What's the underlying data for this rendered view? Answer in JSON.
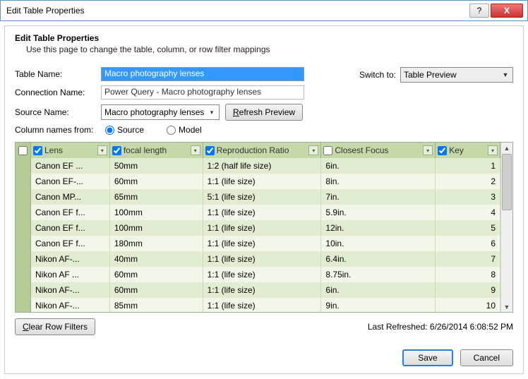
{
  "window": {
    "title": "Edit Table Properties",
    "help": "?",
    "close": "X"
  },
  "header": {
    "title": "Edit Table Properties",
    "subtitle": "Use this page to change the table, column, or row filter mappings"
  },
  "form": {
    "tableNameLabel": "Table Name:",
    "tableName": "Macro photography lenses",
    "connectionNameLabel": "Connection Name:",
    "connectionName": "Power Query - Macro photography lenses",
    "sourceNameLabel": "Source Name:",
    "sourceName": "Macro photography lenses",
    "refreshPreview": "Refresh Preview",
    "columnNamesFromLabel": "Column names from:",
    "radioSource": "Source",
    "radioModel": "Model",
    "switchToLabel": "Switch to:",
    "switchTo": "Table Preview"
  },
  "grid": {
    "columns": [
      "Lens",
      "focal length",
      "Reproduction Ratio",
      "Closest Focus",
      "Key"
    ],
    "rows": [
      [
        "Canon EF ...",
        "50mm",
        "1:2 (half life size)",
        "6in.",
        "1"
      ],
      [
        "Canon EF-...",
        "60mm",
        "1:1 (life size)",
        "8in.",
        "2"
      ],
      [
        "Canon MP...",
        "65mm",
        "5:1 (life size)",
        "7in.",
        "3"
      ],
      [
        "Canon EF f...",
        "100mm",
        "1:1 (life size)",
        "5.9in.",
        "4"
      ],
      [
        "Canon EF f...",
        "100mm",
        "1:1 (life size)",
        "12in.",
        "5"
      ],
      [
        "Canon EF f...",
        "180mm",
        "1:1 (life size)",
        "10in.",
        "6"
      ],
      [
        "Nikon AF-...",
        "40mm",
        "1:1 (life size)",
        "6.4in.",
        "7"
      ],
      [
        "Nikon AF ...",
        "60mm",
        "1:1 (life size)",
        "8.75in.",
        "8"
      ],
      [
        "Nikon AF-...",
        "60mm",
        "1:1 (life size)",
        "6in.",
        "9"
      ],
      [
        "Nikon AF-...",
        "85mm",
        "1:1 (life size)",
        "9in.",
        "10"
      ]
    ]
  },
  "footer": {
    "clearRowFilters": "Clear Row Filters",
    "lastRefreshed": "Last Refreshed: 6/26/2014 6:08:52 PM",
    "save": "Save",
    "cancel": "Cancel"
  }
}
